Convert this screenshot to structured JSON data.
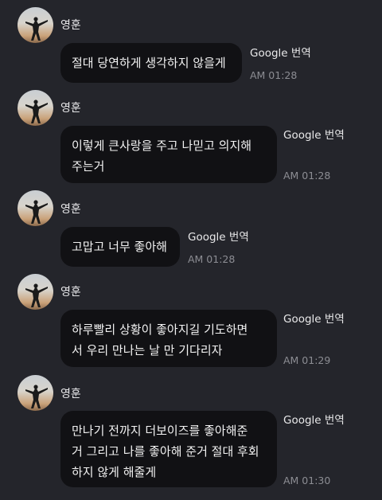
{
  "messages": [
    {
      "sender": "영훈",
      "text": "절대 당연하게 생각하지 않을게",
      "translate": "Google 번역",
      "time": "AM 01:28"
    },
    {
      "sender": "영훈",
      "text": "이렇게 큰사랑을 주고 나믿고 의지해\n주는거",
      "translate": "Google 번역",
      "time": "AM 01:28"
    },
    {
      "sender": "영훈",
      "text": "고맙고 너무 좋아해",
      "translate": "Google 번역",
      "time": "AM 01:28"
    },
    {
      "sender": "영훈",
      "text": "하루빨리 상황이 좋아지길 기도하면\n서 우리 만나는 날 만 기다리자",
      "translate": "Google 번역",
      "time": "AM 01:29"
    },
    {
      "sender": "영훈",
      "text": "만나기 전까지 더보이즈를 좋아해준\n거 그리고 나를 좋아해 준거 절대 후회\n하지 않게 해줄게",
      "translate": "Google 번역",
      "time": "AM 01:30"
    }
  ]
}
